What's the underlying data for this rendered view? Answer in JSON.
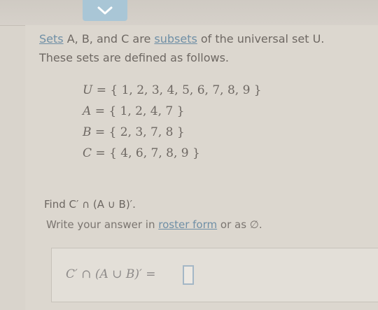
{
  "header": {
    "collapse_icon": "chevron-down-icon",
    "accent": "#a9c6d6"
  },
  "problem": {
    "intro_sets_link": "Sets",
    "intro_part1": " A, B, and C are ",
    "intro_subsets_link": "subsets",
    "intro_part2": " of the universal set U.",
    "intro_line2": "These sets are defined as follows.",
    "sets": [
      {
        "lhs": "U",
        "rhs": "= { 1, 2, 3, 4, 5, 6, 7, 8, 9 }"
      },
      {
        "lhs": "A",
        "rhs": "= { 1, 2, 4, 7 }"
      },
      {
        "lhs": "B",
        "rhs": "= { 2, 3, 7, 8 }"
      },
      {
        "lhs": "C",
        "rhs": "= { 4, 6, 7, 8, 9 }"
      }
    ],
    "find_text": "Find C′ ∩ (A ∪ B)′.",
    "roster_prefix": "Write your answer in ",
    "roster_link": "roster form",
    "roster_suffix": " or as ∅."
  },
  "answer": {
    "label": "C′ ∩ (A ∪ B)′ =",
    "value": ""
  }
}
